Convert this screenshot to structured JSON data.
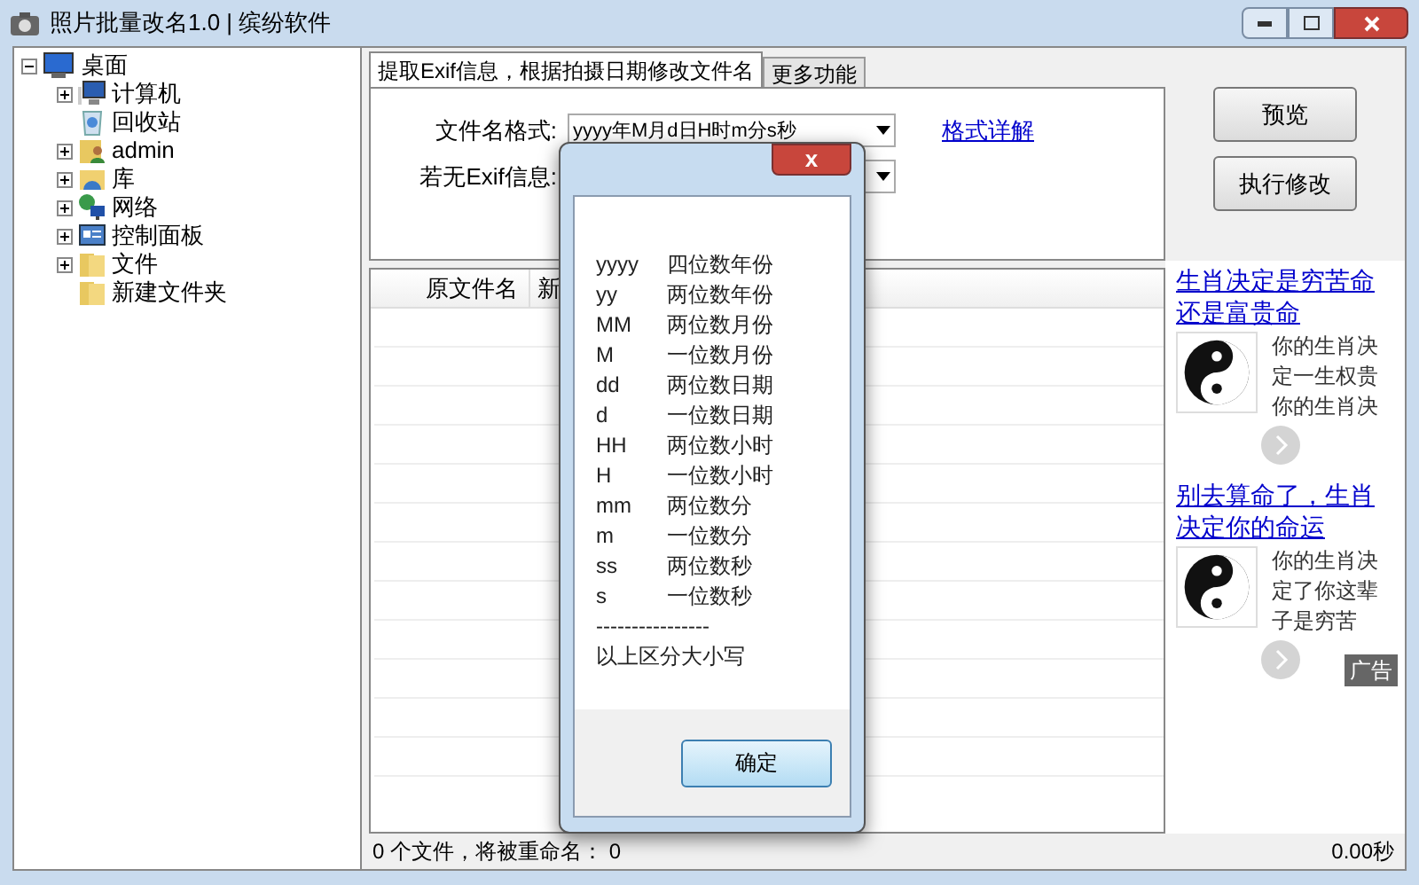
{
  "window": {
    "title": "照片批量改名1.0 | 缤纷软件"
  },
  "tree": {
    "label": "桌面",
    "expanded": true,
    "children": [
      {
        "label": "计算机",
        "kind": "computer",
        "expandable": true
      },
      {
        "label": "回收站",
        "kind": "bin",
        "expandable": false
      },
      {
        "label": "admin",
        "kind": "user",
        "expandable": true
      },
      {
        "label": "库",
        "kind": "library",
        "expandable": true
      },
      {
        "label": "网络",
        "kind": "network",
        "expandable": true
      },
      {
        "label": "控制面板",
        "kind": "panel",
        "expandable": true
      },
      {
        "label": "文件",
        "kind": "folder",
        "expandable": true
      },
      {
        "label": "新建文件夹",
        "kind": "folder",
        "expandable": false
      }
    ]
  },
  "tabs": [
    {
      "label": "提取Exif信息，根据拍摄日期修改文件名",
      "selected": true
    },
    {
      "label": "更多功能",
      "selected": false
    }
  ],
  "form": {
    "format_label": "文件名格式:",
    "format_value": "yyyy年M月d日H时m分s秒",
    "format_link": "格式详解",
    "noexif_label": "若无Exif信息:"
  },
  "buttons": [
    "预览",
    "执行修改"
  ],
  "table": {
    "columns": [
      "原文件名",
      "新"
    ]
  },
  "ads": [
    {
      "title": "生肖决定是穷苦命还是富贵命",
      "lines": [
        "你的生肖决",
        "定一生权贵",
        "你的生肖决"
      ]
    },
    {
      "title": "别去算命了，生肖决定你的命运",
      "lines": [
        "你的生肖决",
        "定了你这辈",
        "子是穷苦"
      ]
    }
  ],
  "ad_badge": "广告",
  "status_bar": {
    "left": "0 个文件，将被重命名： 0",
    "right": "0.00秒"
  },
  "dialog": {
    "rows": [
      [
        "yyyy",
        "四位数年份"
      ],
      [
        "yy",
        "两位数年份"
      ],
      [
        "MM",
        "两位数月份"
      ],
      [
        "M",
        "一位数月份"
      ],
      [
        "dd",
        "两位数日期"
      ],
      [
        "d",
        "一位数日期"
      ],
      [
        "HH",
        "两位数小时"
      ],
      [
        "H",
        "一位数小时"
      ],
      [
        "mm",
        "两位数分"
      ],
      [
        "m",
        "一位数分"
      ],
      [
        "ss",
        "两位数秒"
      ],
      [
        "s",
        "一位数秒"
      ]
    ],
    "separator": "----------------",
    "note": "以上区分大小写",
    "close": "x",
    "ok": "确定"
  }
}
